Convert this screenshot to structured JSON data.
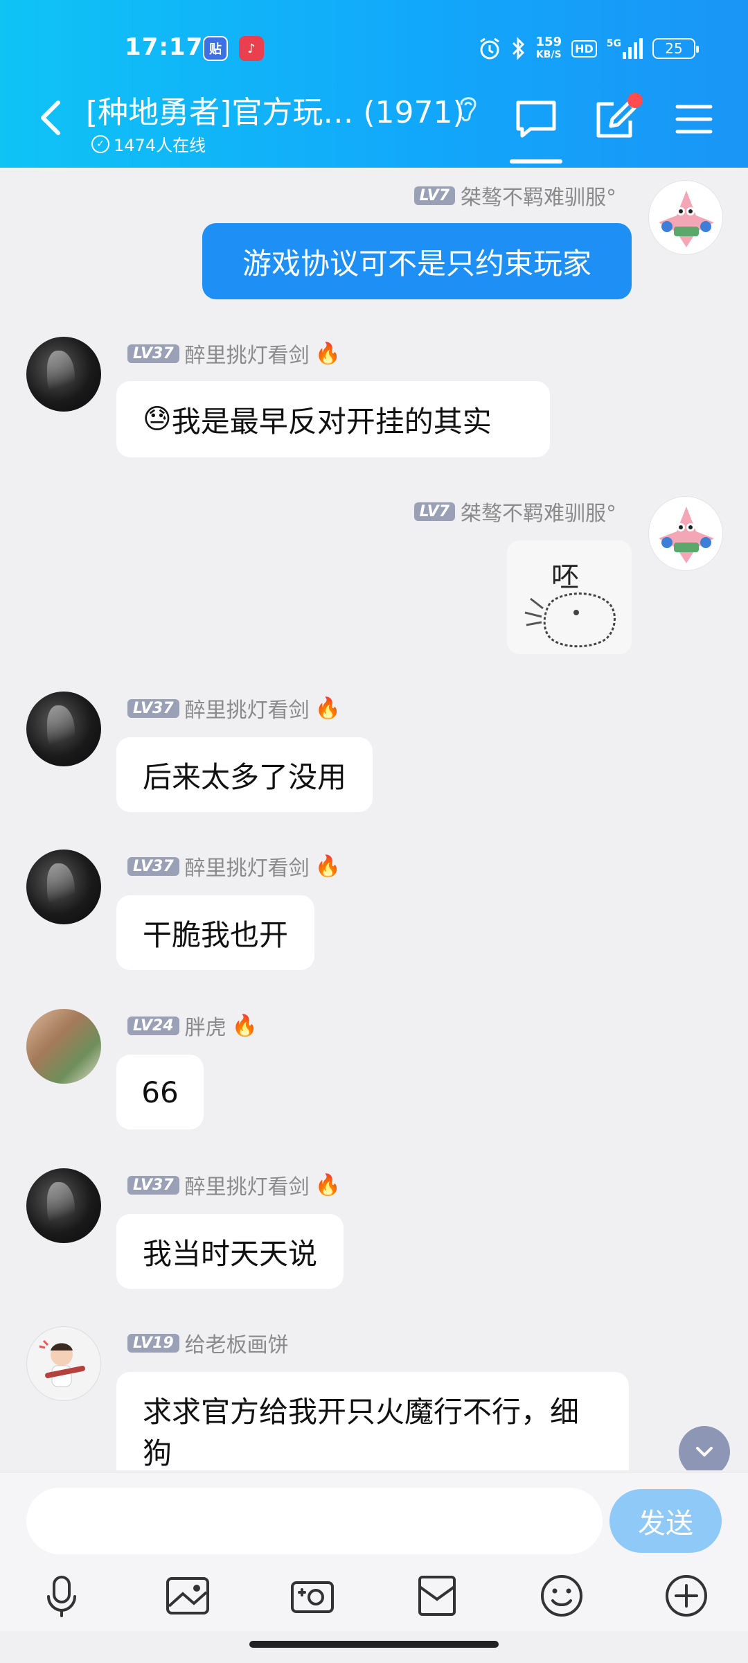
{
  "status_bar": {
    "time": "17:17",
    "tieba_icon_label": "贴",
    "net_speed_value": "159",
    "net_speed_unit": "KB/S",
    "hd_label": "HD",
    "network_label": "5G",
    "battery": "25"
  },
  "header": {
    "title": "[种地勇者]官方玩… (1971)",
    "online_text": "1474人在线"
  },
  "messages": [
    {
      "user": "桀骜不羁难驯服°",
      "level": "LV7",
      "text": "游戏协议可不是只约束玩家"
    },
    {
      "user": "醉里挑灯看剑",
      "level": "LV37",
      "emoji": "😓",
      "text": "我是最早反对开挂的其实"
    },
    {
      "user": "桀骜不羁难驯服°",
      "level": "LV7",
      "sticker_text": "呸"
    },
    {
      "user": "醉里挑灯看剑",
      "level": "LV37",
      "text": "后来太多了没用"
    },
    {
      "user": "醉里挑灯看剑",
      "level": "LV37",
      "text": "干脆我也开"
    },
    {
      "user": "胖虎",
      "level": "LV24",
      "text": "66"
    },
    {
      "user": "醉里挑灯看剑",
      "level": "LV37",
      "text": "我当时天天说"
    },
    {
      "user": "给老板画饼",
      "level": "LV19",
      "text": "求求官方给我开只火魔行不行，细狗"
    }
  ],
  "input": {
    "placeholder": "",
    "send_label": "发送"
  },
  "colors": {
    "header_gradient_start": "#0fc3f5",
    "header_gradient_end": "#1a95f6",
    "my_bubble": "#1e8ff5",
    "send_button": "#8ec9f7",
    "level_badge": "#9aa0b5"
  },
  "icons": [
    "back-icon",
    "ear-icon",
    "chat-icon",
    "edit-icon",
    "menu-icon",
    "voice-icon",
    "image-icon",
    "camera-icon",
    "gift-box-icon",
    "emoji-icon",
    "add-icon",
    "chevron-down-icon",
    "fire-icon"
  ]
}
